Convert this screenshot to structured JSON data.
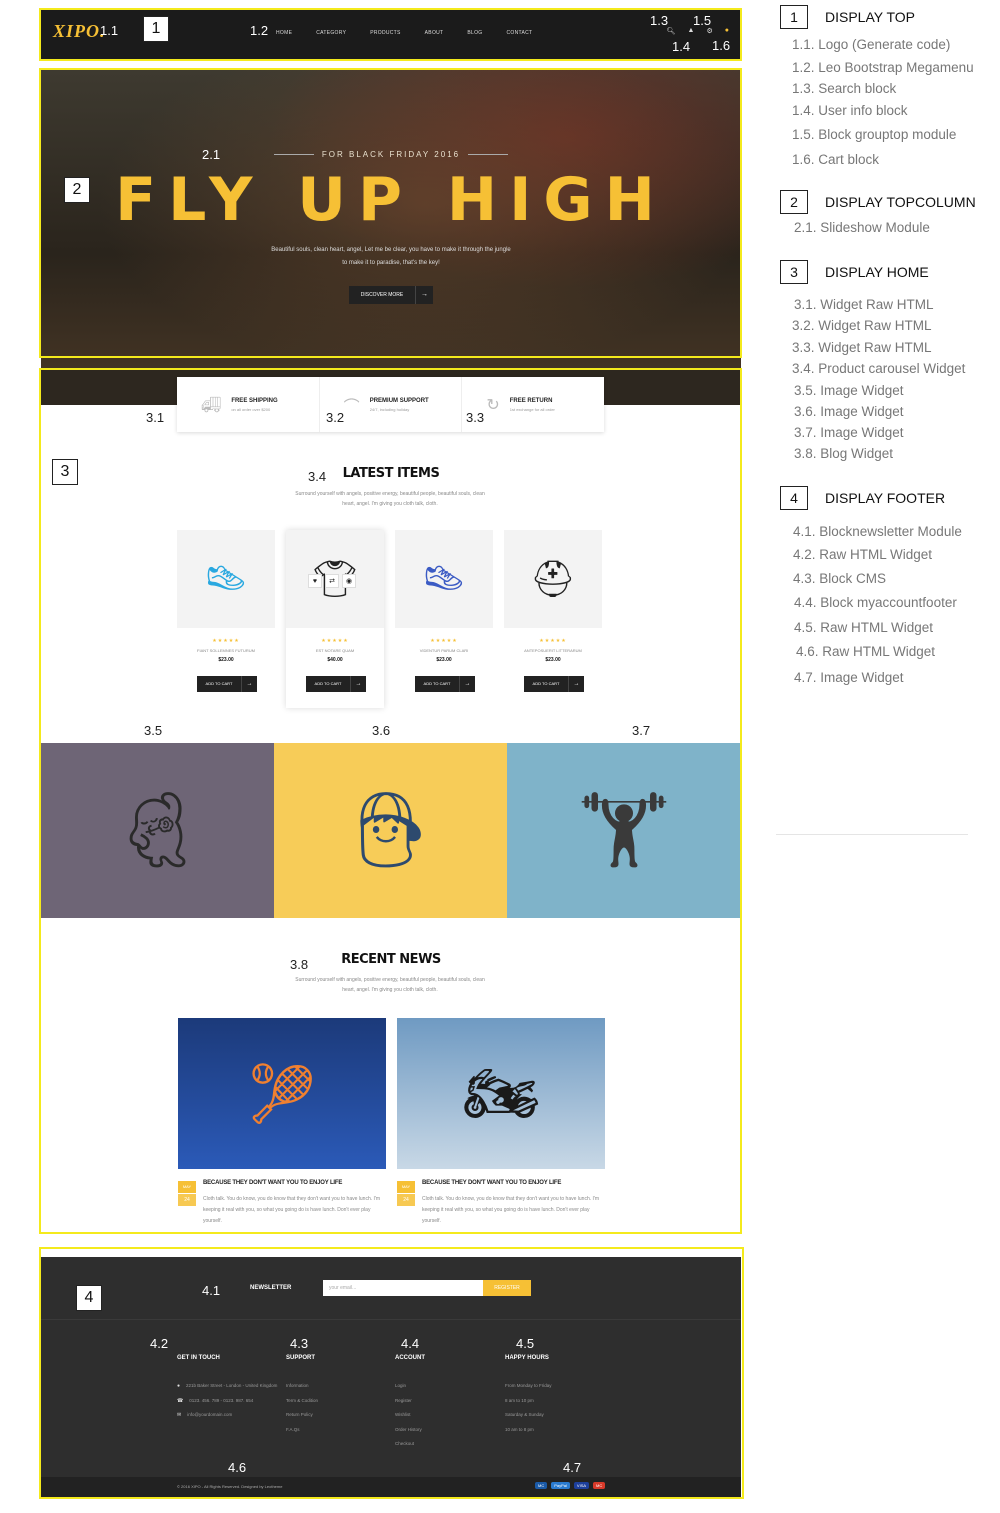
{
  "header": {
    "logo": "XIPO.",
    "menu": [
      "HOME",
      "CATEGORY",
      "PRODUCTS",
      "ABOUT",
      "BLOG",
      "CONTACT"
    ]
  },
  "hero": {
    "subtitle": "FOR BLACK FRIDAY 2016",
    "title": "FLY UP HIGH",
    "text": "Beautiful souls, clean heart, angel, Let me be clear, you have to make it through the jungle to make it to paradise, that's the key!",
    "button": "DISCOVER MORE"
  },
  "features": [
    {
      "icon": "truck-icon",
      "title": "FREE SHIPPING",
      "desc": "on all order over $200"
    },
    {
      "icon": "headset-icon",
      "title": "PREMIUM SUPPORT",
      "desc": "24/7, including holiday"
    },
    {
      "icon": "refresh-icon",
      "title": "FREE RETURN",
      "desc": "1st exchange for all order"
    }
  ],
  "latest": {
    "title": "LATEST ITEMS",
    "desc": "Surround yourself with angels, positive energy, beautiful people, beautiful souls, clean heart, angel. I'm giving you cloth talk, cloth.",
    "products": [
      {
        "name": "FIANT SOLLEMNES FUTURUM",
        "price": "$23.00",
        "rating": 5,
        "img": "shoe-icon"
      },
      {
        "name": "EST NOTARE QUAM",
        "price": "$40.00",
        "rating": 5,
        "img": "shirt-icon"
      },
      {
        "name": "VIDENTUR PARUM CLARI",
        "price": "$23.00",
        "rating": 5,
        "img": "sneaker-icon"
      },
      {
        "name": "ANTEPOSUERIT LITTERARUM",
        "price": "$23.00",
        "rating": 5,
        "img": "helmet-icon"
      }
    ],
    "cart_label": "ADD TO CART"
  },
  "banners": [
    {
      "icon": "woman-fitness-icon",
      "bg": "#6e6576"
    },
    {
      "icon": "child-dumbbell-icon",
      "bg": "#f7cc58"
    },
    {
      "icon": "man-hoodie-icon",
      "bg": "#7fb3c9"
    }
  ],
  "news": {
    "title": "RECENT NEWS",
    "desc": "Surround yourself with angels, positive energy, beautiful people, beautiful souls, clean heart, angel. I'm giving you cloth talk, cloth.",
    "posts": [
      {
        "month": "MAY",
        "day": "24",
        "title": "BECAUSE THEY DON'T WANT YOU TO ENJOY LIFE",
        "text": "Cloth talk. You do know, you do know that they don't want you to have lunch. I'm keeping it real with you, so what you going do is have lunch. Don't ever play yourself.",
        "img": "tennis-icon"
      },
      {
        "month": "MAY",
        "day": "24",
        "title": "BECAUSE THEY DON'T WANT YOU TO ENJOY LIFE",
        "text": "Cloth talk. You do know, you do know that they don't want you to have lunch. I'm keeping it real with you, so what you going do is have lunch. Don't ever play yourself.",
        "img": "motocross-icon"
      }
    ]
  },
  "footer": {
    "newsletter_label": "NEWSLETTER",
    "email_placeholder": "your email...",
    "register": "REGISTER",
    "contact": {
      "title": "GET IN TOUCH",
      "address": "221b Baker Street - London - United Kingdom",
      "phone": "0123. 456. 789 - 0123. 987. 654",
      "email": "info@yourdomain.com"
    },
    "support": {
      "title": "SUPPORT",
      "links": [
        "Information",
        "Term & Codition",
        "Return Policy",
        "F.A.Qs"
      ]
    },
    "account": {
      "title": "ACCOUNT",
      "links": [
        "Login",
        "Register",
        "Wishlist",
        "Order History",
        "Checkout"
      ]
    },
    "hours": {
      "title": "HAPPY HOURS",
      "lines": [
        "From Monday to Friday",
        "8 am to 10 pm",
        "Saturday & Sunday",
        "10 am to 8 pm"
      ]
    },
    "copyright": "© 2016 XIPO - All Rights Reserved. Designed by Leotheme",
    "payments": [
      "MC",
      "PayPal",
      "VISA",
      "MC"
    ]
  },
  "annotations": {
    "boxes": [
      "1",
      "2",
      "3",
      "4"
    ],
    "labels": [
      "1.1",
      "1.2",
      "1.3",
      "1.4",
      "1.5",
      "1.6",
      "2.1",
      "3.1",
      "3.2",
      "3.3",
      "3.4",
      "3.5",
      "3.6",
      "3.7",
      "3.8",
      "4.1",
      "4.2",
      "4.3",
      "4.4",
      "4.5",
      "4.6",
      "4.7"
    ]
  },
  "legend": [
    {
      "num": "1",
      "title": "DISPLAY TOP",
      "items": [
        "1.1. Logo (Generate code)",
        "1.2. Leo Bootstrap Megamenu",
        "1.3. Search  block",
        "1.4. User info block",
        "1.5. Block grouptop module",
        "1.6. Cart block"
      ]
    },
    {
      "num": "2",
      "title": "DISPLAY TOPCOLUMN",
      "items": [
        "2.1. Slideshow Module"
      ]
    },
    {
      "num": "3",
      "title": "DISPLAY HOME",
      "items": [
        "3.1. Widget Raw HTML",
        "3.2. Widget Raw HTML",
        "3.3. Widget Raw HTML",
        "3.4. Product carousel Widget",
        "3.5. Image Widget",
        "3.6. Image Widget",
        "3.7. Image Widget",
        "3.8. Blog Widget"
      ]
    },
    {
      "num": "4",
      "title": "DISPLAY FOOTER",
      "items": [
        "4.1. Blocknewsletter Module",
        "4.2. Raw HTML Widget",
        "4.3. Block CMS",
        "4.4. Block myaccountfooter",
        "4.5. Raw HTML Widget",
        "4.6. Raw HTML Widget",
        "4.7. Image Widget"
      ]
    }
  ]
}
